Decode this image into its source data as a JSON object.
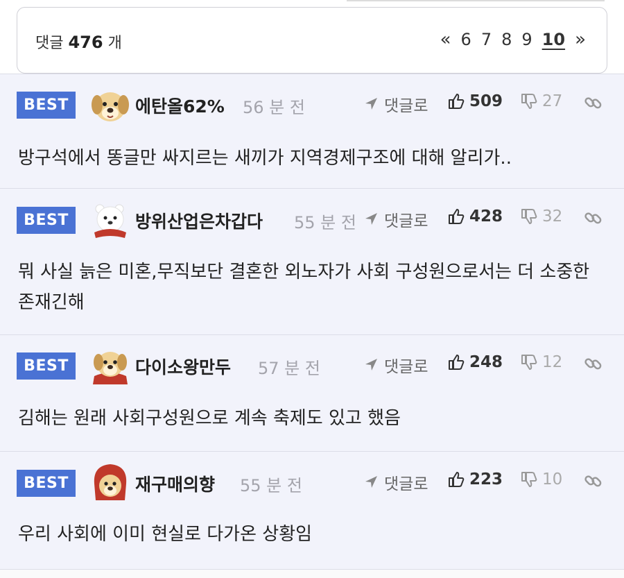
{
  "summary": {
    "label": "댓글",
    "count": "476",
    "unit": "개"
  },
  "pager": {
    "prev": "«",
    "pages": [
      "6",
      "7",
      "8",
      "9"
    ],
    "current": "10",
    "next": "»"
  },
  "badge": "BEST",
  "reply_label": "댓글로",
  "comments": [
    {
      "nick": "에탄올62%",
      "time": "56 분 전",
      "likes": "509",
      "dislikes": "27",
      "avatar": "dog-icon",
      "text": "방구석에서 똥글만 싸지르는 새끼가 지역경제구조에 대해 알리가.."
    },
    {
      "nick": "방위산업은차갑다",
      "time": "55 분 전",
      "likes": "428",
      "dislikes": "32",
      "avatar": "polar-bear-icon",
      "text": "뭐 사실 늙은 미혼,무직보단 결혼한 외노자가 사회 구성원으로서는 더 소중한 존재긴해"
    },
    {
      "nick": "다이소왕만두",
      "time": "57 분 전",
      "likes": "248",
      "dislikes": "12",
      "avatar": "dog-cape-icon",
      "text": "김해는 원래 사회구성원으로 계속 축제도 있고 했음"
    },
    {
      "nick": "재구매의향",
      "time": "55 분 전",
      "likes": "223",
      "dislikes": "10",
      "avatar": "dog-hood-icon",
      "text": "우리 사회에 이미 현실로 다가온 상황임"
    }
  ],
  "colors": {
    "badge": "#4a72d4",
    "comment_bg": "#f2f3fb",
    "time": "#a4a4ac"
  }
}
